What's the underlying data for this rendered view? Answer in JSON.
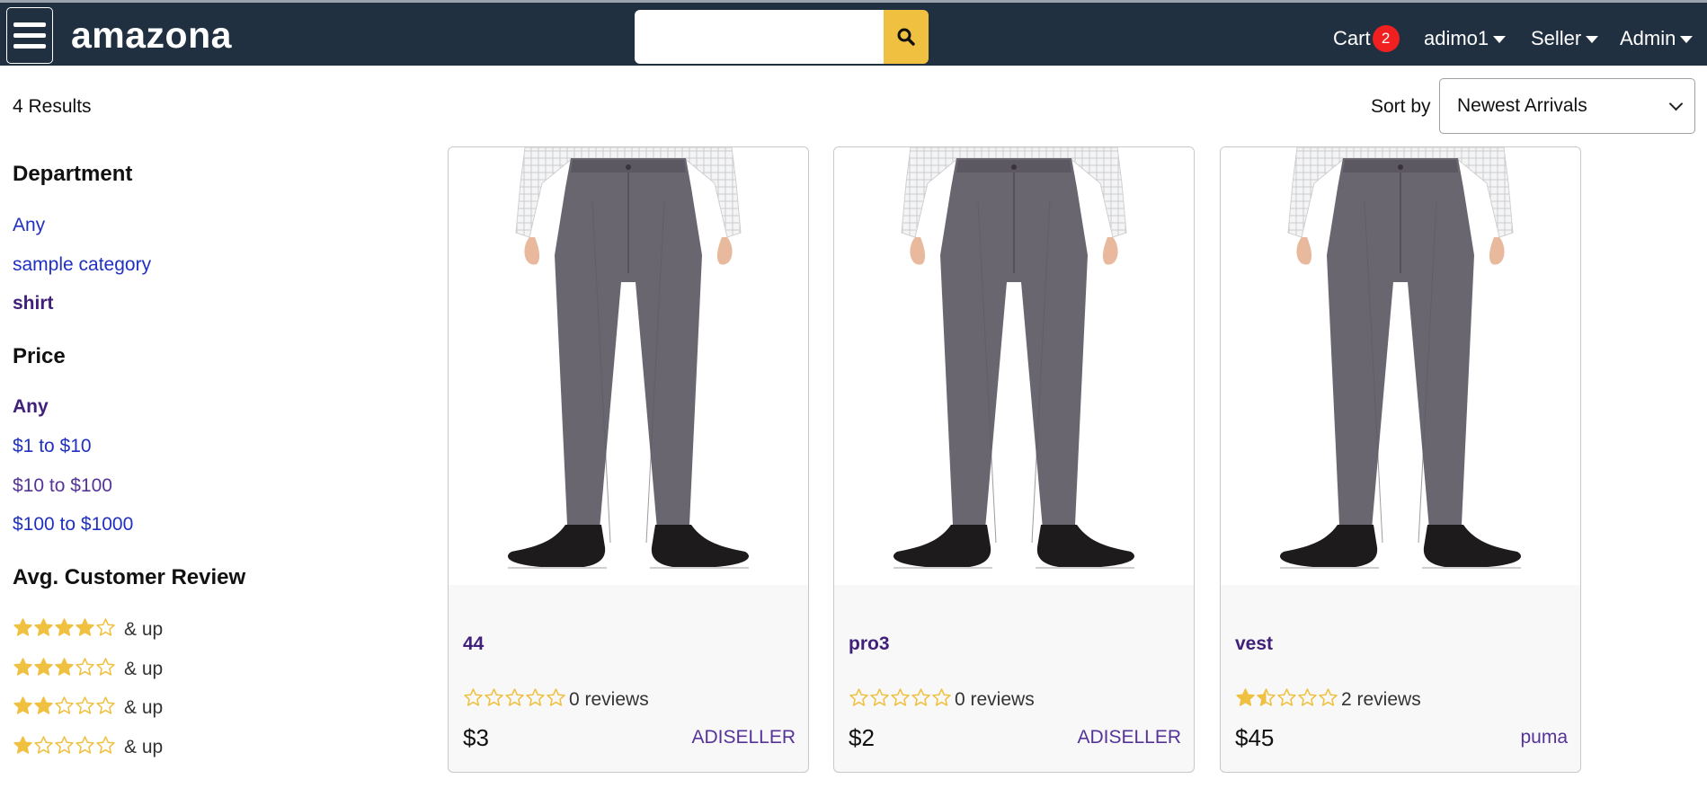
{
  "header": {
    "brand": "amazona",
    "search_placeholder": "",
    "cart_label": "Cart",
    "cart_count": "2",
    "user_label": "adimo1",
    "seller_label": "Seller",
    "admin_label": "Admin"
  },
  "results": {
    "count_text": "4 Results",
    "sort_label": "Sort by",
    "sort_selected": "Newest Arrivals"
  },
  "sidebar": {
    "department_title": "Department",
    "departments": [
      {
        "label": "Any"
      },
      {
        "label": "sample category"
      },
      {
        "label": "shirt"
      }
    ],
    "price_title": "Price",
    "prices": [
      {
        "label": "Any"
      },
      {
        "label": "$1 to $10"
      },
      {
        "label": "$10 to $100"
      },
      {
        "label": "$100 to $1000"
      }
    ],
    "review_title": "Avg. Customer Review",
    "review_suffix": "& up",
    "review_filters": [
      {
        "stars": 4
      },
      {
        "stars": 3
      },
      {
        "stars": 2
      },
      {
        "stars": 1
      }
    ]
  },
  "products": [
    {
      "name": "44",
      "rating": 0,
      "reviews_text": "0 reviews",
      "price": "$3",
      "seller": "ADISELLER"
    },
    {
      "name": "pro3",
      "rating": 0,
      "reviews_text": "0 reviews",
      "price": "$2",
      "seller": "ADISELLER"
    },
    {
      "name": "vest",
      "rating": 1.5,
      "reviews_text": "2 reviews",
      "price": "$45",
      "seller": "puma"
    }
  ],
  "colors": {
    "header_bg": "#203040",
    "accent": "#f0c040",
    "star": "#f0c040",
    "badge": "#f02020",
    "link": "#2030c0",
    "visited": "#40207a"
  }
}
